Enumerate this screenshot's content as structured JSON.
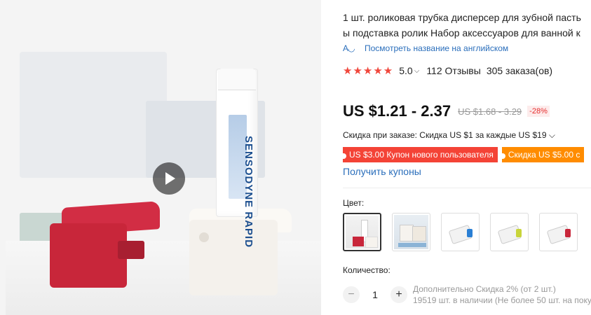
{
  "gallery": {
    "tube_brand": "SENSODYNE RAPID"
  },
  "product": {
    "title_line1": "1 шт. роликовая трубка дисперсер для зубной пасть",
    "title_line2": "ы подставка ролик Набор аксессуаров для ванной к",
    "translate_link": "Посмотреть название на английском",
    "rating_value": "5.0",
    "reviews": "112 Отзывы",
    "orders": "305 заказа(ов)",
    "price": "US $1.21 - 2.37",
    "old_price": "US $1.68 - 3.29",
    "discount": "-28%",
    "store_discount": "Скидка при заказе: Скидка US $1 за каждые US $19",
    "coupon_new_user": "US $3.00 Купон нового пользователя",
    "coupon_discount": "Скидка US $5.00 с",
    "get_coupons": "Получить купоны",
    "color_label": "Цвет:",
    "quantity_label": "Количество:",
    "quantity_value": "1",
    "quantity_discount": "Дополнительно Скидка 2% (от 2 шт.)",
    "stock_info": "19519 шт. в наличии (Не более 50 шт. на поку"
  },
  "colors": {
    "accent_red": "#f44336",
    "accent_orange": "#ff8c00",
    "link_blue": "#2a6ebb",
    "star_red": "#f0463b"
  },
  "icons": [
    "play-icon",
    "translate-icon",
    "star-icon",
    "chevron-down-icon",
    "minus-icon",
    "plus-icon"
  ]
}
